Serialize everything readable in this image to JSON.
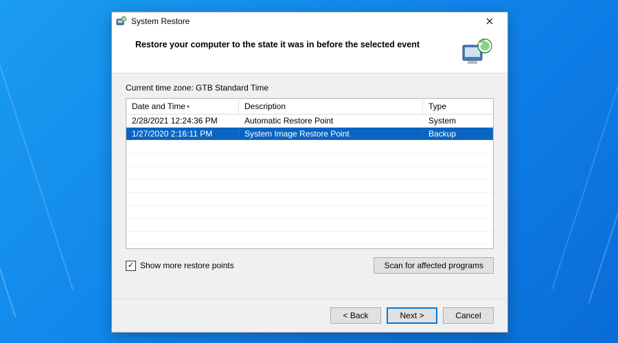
{
  "window": {
    "title": "System Restore",
    "heading": "Restore your computer to the state it was in before the selected event"
  },
  "timezone_label": "Current time zone: GTB Standard Time",
  "columns": {
    "date": "Date and Time",
    "desc": "Description",
    "type": "Type"
  },
  "rows": [
    {
      "date": "2/28/2021 12:24:36 PM",
      "desc": "Automatic Restore Point",
      "type": "System",
      "selected": false
    },
    {
      "date": "1/27/2020 2:16:11 PM",
      "desc": "System Image Restore Point",
      "type": "Backup",
      "selected": true
    }
  ],
  "checkbox": {
    "label": "Show more restore points",
    "checked": true
  },
  "buttons": {
    "scan": "Scan for affected programs",
    "back": "< Back",
    "next": "Next >",
    "cancel": "Cancel"
  }
}
